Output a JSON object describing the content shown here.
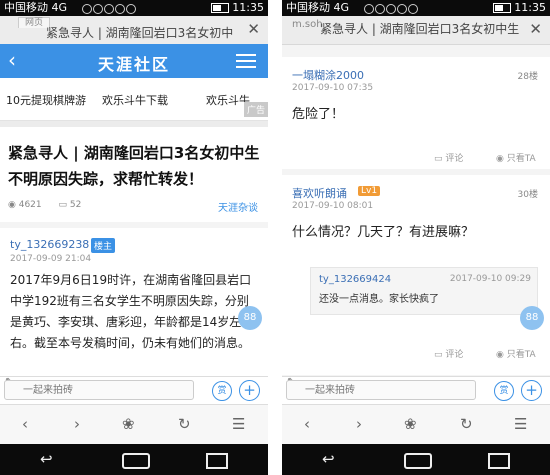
{
  "status": {
    "carrier": "中国移动 4G",
    "time": "11:35"
  },
  "left": {
    "tab": {
      "ghost": "网页",
      "title": "紧急寻人 | 湖南隆回岩口3名女初中"
    },
    "site_logo": "天涯社区",
    "ads": [
      "10元提现棋牌游",
      "欢乐斗牛下载",
      "欢乐斗牛"
    ],
    "ad_tag": "广告",
    "post": {
      "title": "紧急寻人 | 湖南隆回岩口3名女初中生不明原因失踪，求帮忙转发！",
      "views": "4621",
      "replies": "52",
      "channel": "天涯杂谈",
      "author": "ty_132669238",
      "author_tag": "楼主",
      "date": "2017-09-09 21:04",
      "body": "2017年9月6日19时许，在湖南省隆回县岩口中学192班有三名女学生不明原因失踪，分别是黄巧、李安琪、唐彩迎，年龄都是14岁左右。截至本号发稿时间，仍未有她们的消息。"
    }
  },
  "right": {
    "tab": {
      "ghost": "m.soh",
      "title": "紧急寻人 | 湖南隆回岩口3名女初中生"
    },
    "comments": [
      {
        "user": "一塌糊涂2000",
        "floor": "28楼",
        "date": "2017-09-10 07:35",
        "text": "危险了！",
        "comment_label": "评论",
        "ta_label": "只看TA"
      },
      {
        "user": "喜欢听朗诵",
        "level": "Lv1",
        "floor": "30楼",
        "date": "2017-09-10 08:01",
        "text": "什么情况？几天了？有进展嘛？",
        "comment_label": "评论",
        "ta_label": "只看TA",
        "reply": {
          "user": "ty_132669424",
          "date": "2017-09-10 09:29",
          "text": "还没一点消息。家长快疯了"
        }
      }
    ]
  },
  "bottombar": {
    "placeholder": "一起来拍砖",
    "reward": "赏",
    "add": "+"
  },
  "icons": {
    "float_btn": "88"
  },
  "colors": {
    "accent": "#3b91e5",
    "level_badge": "#f19b36"
  }
}
